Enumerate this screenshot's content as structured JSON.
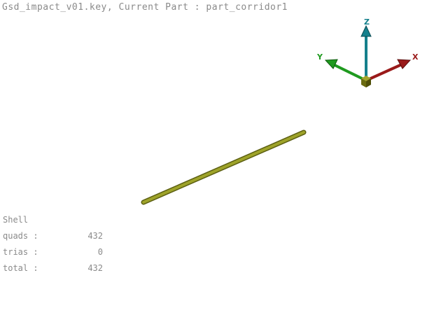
{
  "header": {
    "title": "Gsd_impact_v01.key,   Current Part : part_corridor1"
  },
  "triad": {
    "x_label": "X",
    "y_label": "Y",
    "z_label": "Z",
    "x_color": "#9a1a1a",
    "y_color": "#1f9a1f",
    "z_color": "#15808c",
    "origin_color": "#6b6b10"
  },
  "model": {
    "part_color": "#9ea329",
    "part_shape": "beam"
  },
  "stats": {
    "heading": "Shell",
    "rows": [
      {
        "label": "quads :",
        "value": "432"
      },
      {
        "label": "trias :",
        "value": "0"
      },
      {
        "label": "total :",
        "value": "432"
      }
    ]
  }
}
